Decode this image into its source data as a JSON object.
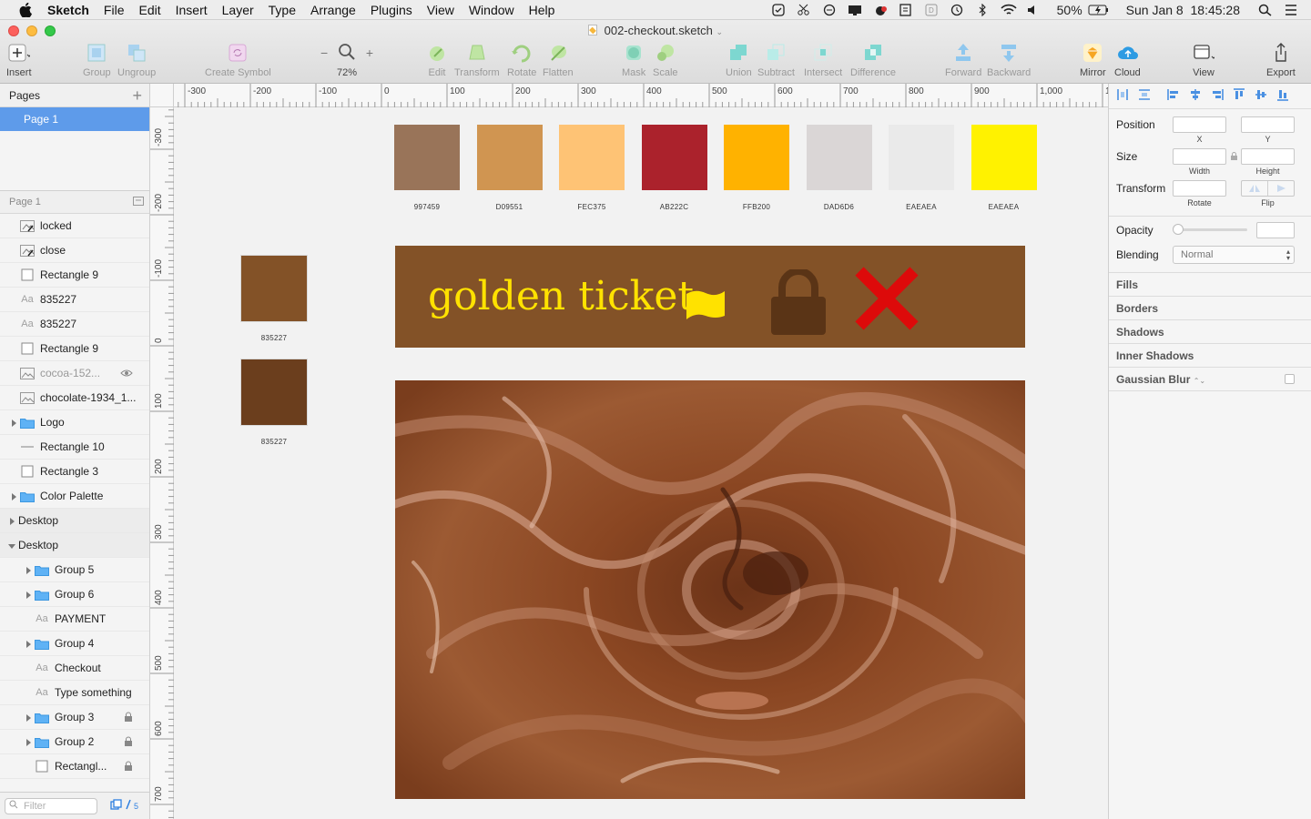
{
  "menubar": {
    "app_name": "Sketch",
    "items": [
      "File",
      "Edit",
      "Insert",
      "Layer",
      "Type",
      "Arrange",
      "Plugins",
      "View",
      "Window",
      "Help"
    ],
    "battery": "50%",
    "datetime": "Sun Jan 8  18:45:28"
  },
  "window": {
    "title": "002-checkout.sketch"
  },
  "toolbar": {
    "insert": "Insert",
    "group": "Group",
    "ungroup": "Ungroup",
    "create_symbol": "Create Symbol",
    "zoom": "72%",
    "zoom_minus": "−",
    "zoom_plus": "+",
    "edit": "Edit",
    "transform": "Transform",
    "rotate": "Rotate",
    "flatten": "Flatten",
    "mask": "Mask",
    "scale": "Scale",
    "union": "Union",
    "subtract": "Subtract",
    "intersect": "Intersect",
    "difference": "Difference",
    "forward": "Forward",
    "backward": "Backward",
    "mirror": "Mirror",
    "cloud": "Cloud",
    "view": "View",
    "export": "Export"
  },
  "sidebar": {
    "pages_label": "Pages",
    "pages": [
      "Page 1"
    ],
    "layers_label": "Page 1",
    "layers": [
      {
        "label": "locked",
        "icon": "symbol",
        "indent": 0,
        "arrow": false,
        "lock": false
      },
      {
        "label": "close",
        "icon": "symbol",
        "indent": 0,
        "arrow": false,
        "lock": false
      },
      {
        "label": "Rectangle 9",
        "icon": "rect",
        "indent": 0,
        "arrow": false,
        "lock": false
      },
      {
        "label": "835227",
        "icon": "text",
        "indent": 0,
        "arrow": false,
        "lock": false
      },
      {
        "label": "835227",
        "icon": "text",
        "indent": 0,
        "arrow": false,
        "lock": false
      },
      {
        "label": "Rectangle 9",
        "icon": "rect",
        "indent": 0,
        "arrow": false,
        "lock": false
      },
      {
        "label": "cocoa-152...",
        "icon": "image",
        "indent": 0,
        "arrow": false,
        "lock": false,
        "hidden": true
      },
      {
        "label": "chocolate-1934_1...",
        "icon": "image",
        "indent": 0,
        "arrow": false,
        "lock": false
      },
      {
        "label": "Logo",
        "icon": "folder",
        "indent": 0,
        "arrow": true,
        "lock": false
      },
      {
        "label": "Rectangle 10",
        "icon": "line",
        "indent": 0,
        "arrow": false,
        "lock": false
      },
      {
        "label": "Rectangle 3",
        "icon": "rect",
        "indent": 0,
        "arrow": false,
        "lock": false
      },
      {
        "label": "Color Palette",
        "icon": "folder",
        "indent": 0,
        "arrow": true,
        "lock": false
      },
      {
        "label": "Desktop",
        "icon": "none",
        "indent": -1,
        "arrow": true,
        "lock": false,
        "artboard": true
      },
      {
        "label": "Desktop",
        "icon": "none",
        "indent": -1,
        "arrow": true,
        "lock": false,
        "artboard": true,
        "open": true
      },
      {
        "label": "Group 5",
        "icon": "folder",
        "indent": 1,
        "arrow": true,
        "lock": false
      },
      {
        "label": "Group 6",
        "icon": "folder",
        "indent": 1,
        "arrow": true,
        "lock": false
      },
      {
        "label": "PAYMENT",
        "icon": "text",
        "indent": 1,
        "arrow": false,
        "lock": false
      },
      {
        "label": "Group 4",
        "icon": "folder",
        "indent": 1,
        "arrow": true,
        "lock": false
      },
      {
        "label": "Checkout",
        "icon": "text",
        "indent": 1,
        "arrow": false,
        "lock": false
      },
      {
        "label": "Type something",
        "icon": "text",
        "indent": 1,
        "arrow": false,
        "lock": false
      },
      {
        "label": "Group 3",
        "icon": "folder",
        "indent": 1,
        "arrow": true,
        "lock": true
      },
      {
        "label": "Group 2",
        "icon": "folder",
        "indent": 1,
        "arrow": true,
        "lock": true
      },
      {
        "label": "Rectangl...",
        "icon": "rect",
        "indent": 1,
        "arrow": false,
        "lock": true
      }
    ],
    "filter_placeholder": "Filter",
    "filter_count": "5"
  },
  "canvas": {
    "ruler_top": [
      "-300",
      "-200",
      "-100",
      "0",
      "100",
      "200",
      "300",
      "400",
      "500",
      "600",
      "700",
      "800",
      "900",
      "1,000",
      "1,"
    ],
    "ruler_left": [
      "-300",
      "-200",
      "-100",
      "0",
      "100",
      "200",
      "300",
      "400",
      "500",
      "600",
      "700"
    ],
    "palette": [
      {
        "hex": "#997459",
        "label": "997459"
      },
      {
        "hex": "#D09551",
        "label": "D09551"
      },
      {
        "hex": "#FEC375",
        "label": "FEC375"
      },
      {
        "hex": "#AB222C",
        "label": "AB222C"
      },
      {
        "hex": "#FFB200",
        "label": "FFB200"
      },
      {
        "hex": "#DAD6D6",
        "label": "DAD6D6"
      },
      {
        "hex": "#EAEAEA",
        "label": "EAEAEA"
      },
      {
        "hex": "#FFF200",
        "label": "EAEAEA"
      }
    ],
    "side_swatches": [
      {
        "hex": "#835227",
        "label": "835227"
      },
      {
        "hex": "#6B3E1D",
        "label": "835227"
      }
    ],
    "banner": {
      "text": "golden ticket",
      "bg": "#835227",
      "text_color": "#FFE200",
      "icons": [
        "flag-icon",
        "lock-icon",
        "close-icon"
      ]
    }
  },
  "inspector": {
    "position_label": "Position",
    "x_label": "X",
    "y_label": "Y",
    "size_label": "Size",
    "width_label": "Width",
    "height_label": "Height",
    "transform_label": "Transform",
    "rotate_label": "Rotate",
    "flip_label": "Flip",
    "opacity_label": "Opacity",
    "blending_label": "Blending",
    "blending_value": "Normal",
    "fills": "Fills",
    "borders": "Borders",
    "shadows": "Shadows",
    "inner_shadows": "Inner Shadows",
    "gaussian_blur": "Gaussian Blur"
  }
}
